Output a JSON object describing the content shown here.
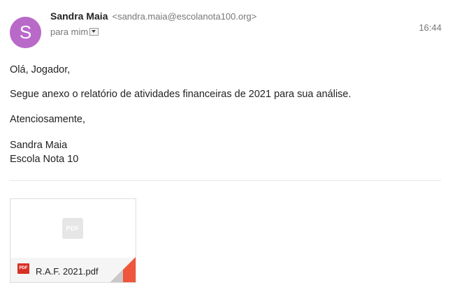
{
  "header": {
    "avatar_letter": "S",
    "avatar_color": "#b96ac9",
    "sender_name": "Sandra Maia",
    "sender_email": "<sandra.maia@escolanota100.org>",
    "recipient": "para mim",
    "time": "16:44"
  },
  "body": {
    "greeting": "Olá, Jogador,",
    "message": "Segue anexo o relatório de atividades financeiras de 2021 para sua análise.",
    "closing": "Atenciosamente,",
    "signature_name": "Sandra Maia",
    "signature_org": "Escola Nota 10"
  },
  "attachment": {
    "preview_icon_label": "PDF",
    "type_badge": "PDF",
    "file_name": "R.A.F. 2021.pdf",
    "icon": "pdf-file-icon",
    "badge_color": "#d93025"
  }
}
